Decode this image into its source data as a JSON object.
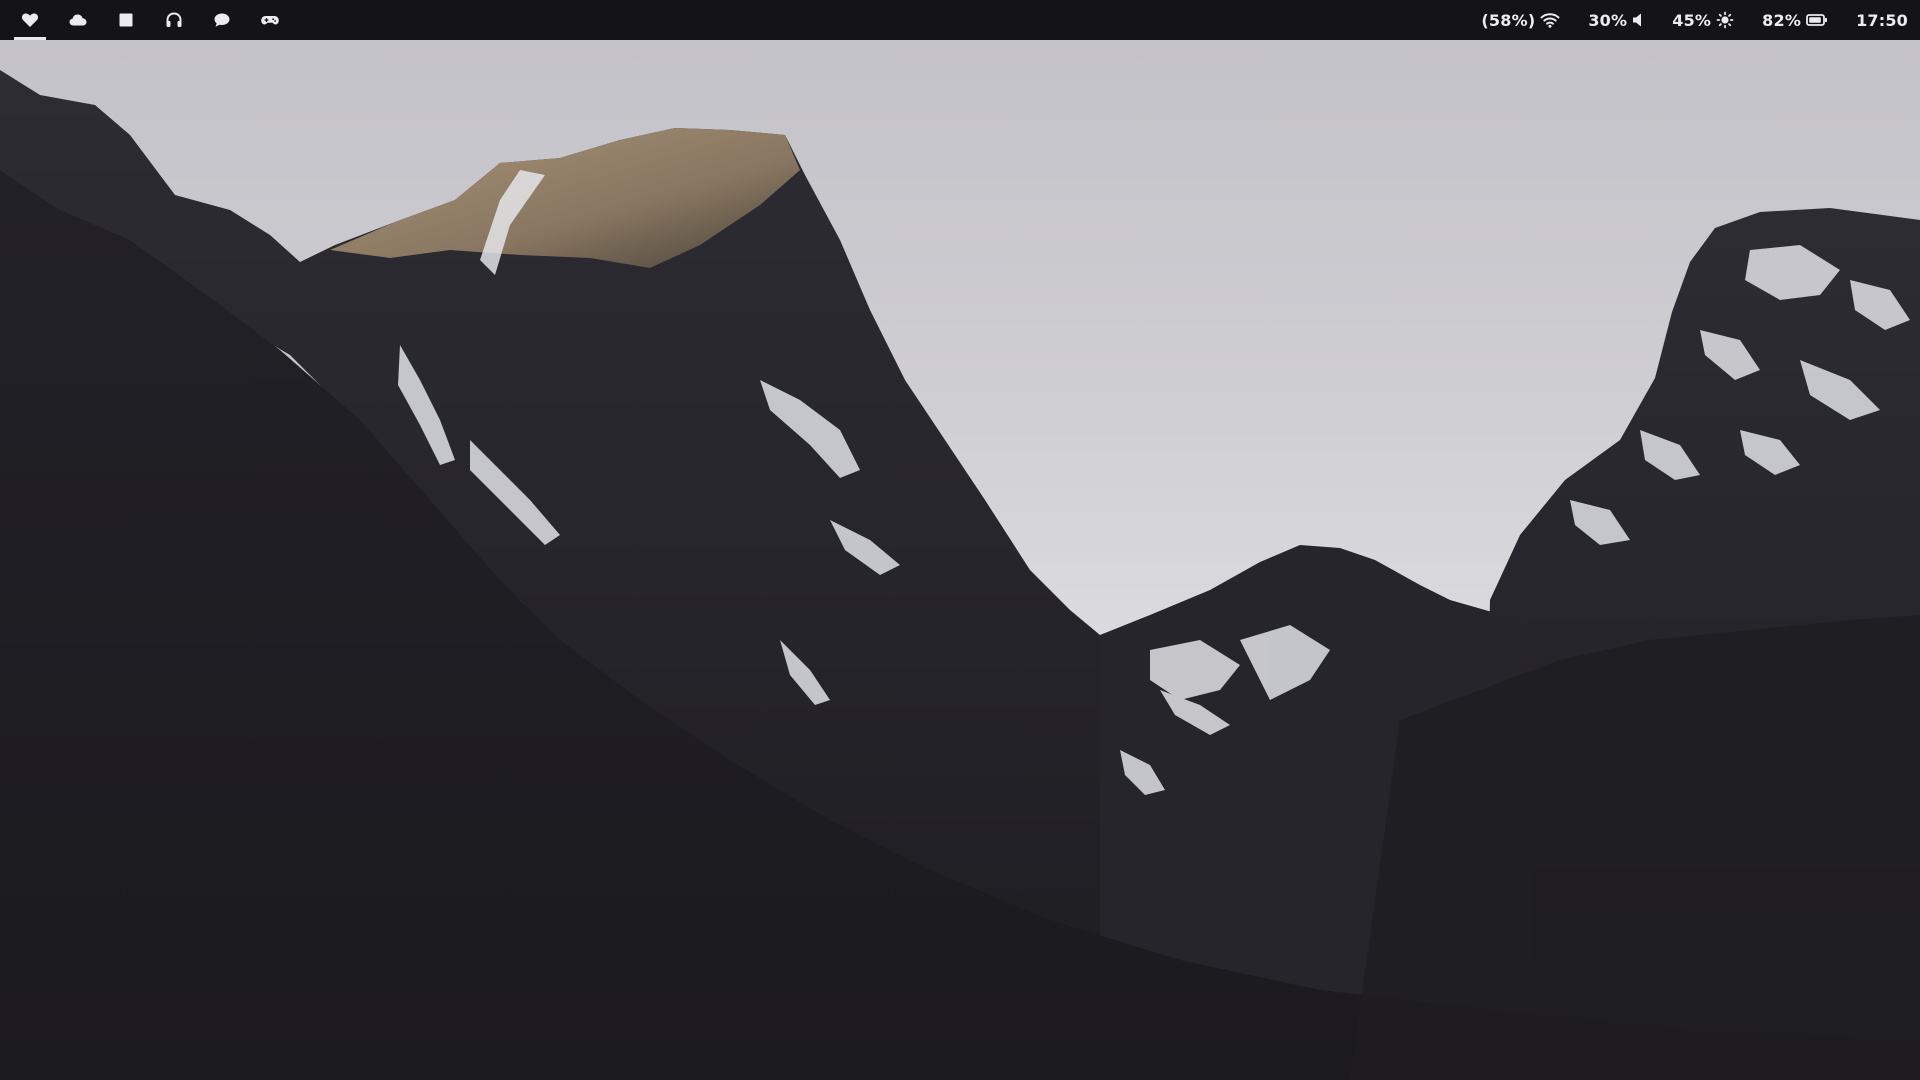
{
  "topbar": {
    "workspaces": [
      {
        "name": "heart",
        "active": true
      },
      {
        "name": "cloud",
        "active": false
      },
      {
        "name": "square",
        "active": false
      },
      {
        "name": "headphones",
        "active": false
      },
      {
        "name": "chat",
        "active": false
      },
      {
        "name": "gamepad",
        "active": false
      }
    ],
    "status": {
      "wifi": {
        "value": "(58%)",
        "icon": "wifi-icon"
      },
      "volume": {
        "value": "30%",
        "icon": "volume-icon"
      },
      "brightness": {
        "value": "45%",
        "icon": "brightness-icon"
      },
      "battery": {
        "value": "82%",
        "icon": "battery-icon"
      },
      "clock": "17:50"
    },
    "colors": {
      "bar": "#141416",
      "text": "#ececef"
    }
  },
  "wallpaper": {
    "subject": "dark mountain peaks with snow under an overcast sky",
    "colors": {
      "sky_top": "#c9c8cd",
      "sky_bottom": "#e2e2e6",
      "rock": "#24232a",
      "shadow": "#1c1b20",
      "sunlit": "#9a8467",
      "snow": "#e8e9ee"
    }
  }
}
